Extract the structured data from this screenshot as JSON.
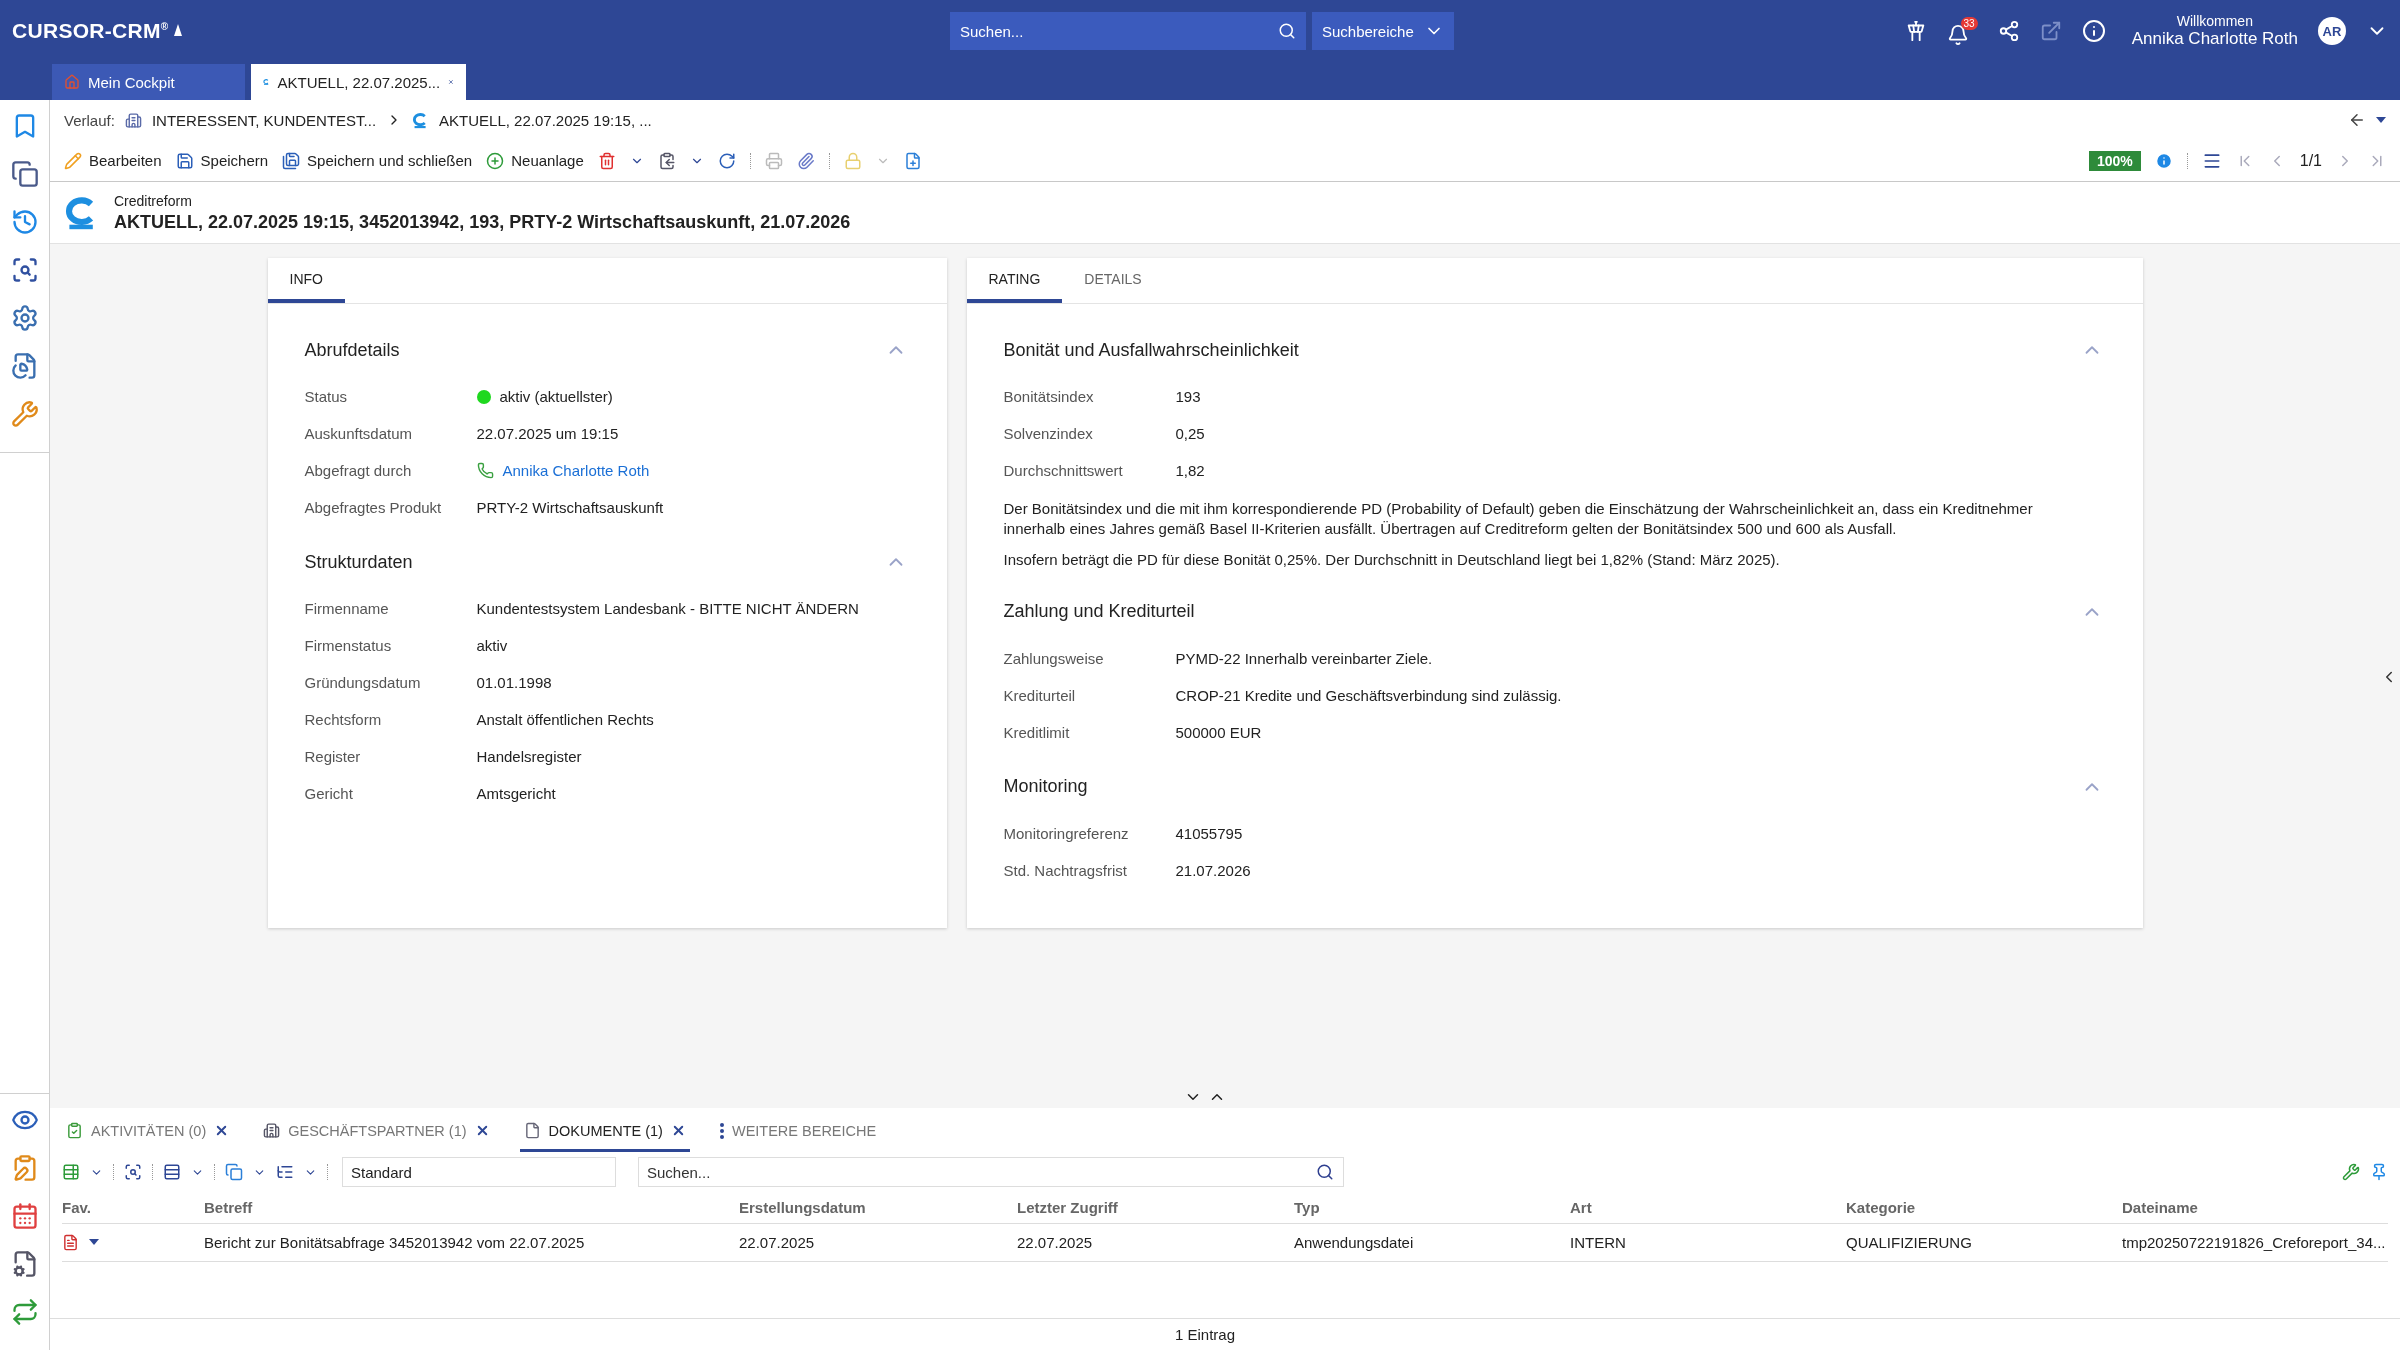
{
  "header": {
    "logo": "CURSOR-CRM$^{®}$",
    "search": {
      "placeholder": "Suchen..."
    },
    "search_areas": "Suchbereiche",
    "notification_count": "33",
    "greeting": "Willkommen",
    "user": "Annika Charlotte Roth",
    "avatar": "AR"
  },
  "main_tabs": [
    {
      "label": "Mein Cockpit",
      "kind": "home",
      "selected": false,
      "closable": false
    },
    {
      "label": "AKTUELL, 22.07.2025...",
      "kind": "record",
      "selected": true,
      "closable": true
    }
  ],
  "breadcrumb": {
    "label": "Verlauf:",
    "items": [
      {
        "label": "INTERESSENT, KUNDENTEST...",
        "kind": "partner"
      },
      {
        "label": "AKTUELL, 22.07.2025 19:15, ...",
        "kind": "record"
      }
    ]
  },
  "toolbar": {
    "actions": [
      {
        "label": "Bearbeiten",
        "kind": "edit"
      },
      {
        "label": "Speichern",
        "kind": "save"
      },
      {
        "label": "Speichern und schließen",
        "kind": "save_close"
      },
      {
        "label": "Neuanlage",
        "kind": "new"
      }
    ],
    "completeness": "100%",
    "pager": "1/1"
  },
  "record": {
    "source": "Creditreform",
    "title": "AKTUELL, 22.07.2025 19:15, 3452013942, 193, PRTY-2 Wirtschaftsauskunft, 21.07.2026"
  },
  "panels": [
    {
      "tabs": [
        {
          "label": "INFO",
          "selected": true
        }
      ],
      "sections": [
        {
          "title": "Abrufdetails",
          "expanded": true,
          "fields": [
            {
              "label": "Status",
              "value": "aktiv (aktuellster)",
              "kind": "status",
              "color": "#1fd81f"
            },
            {
              "label": "Auskunftsdatum",
              "value": "22.07.2025 um 19:15",
              "kind": "text"
            },
            {
              "label": "Abgefragt durch",
              "value": "Annika Charlotte Roth",
              "kind": "link"
            },
            {
              "label": "Abgefragtes Produkt",
              "value": "PRTY-2 Wirtschaftsauskunft",
              "kind": "text"
            }
          ]
        },
        {
          "title": "Strukturdaten",
          "expanded": true,
          "fields": [
            {
              "label": "Firmenname",
              "value": "Kundentestsystem Landesbank - BITTE NICHT ÄNDERN",
              "kind": "text"
            },
            {
              "label": "Firmenstatus",
              "value": "aktiv",
              "kind": "text"
            },
            {
              "label": "Gründungsdatum",
              "value": "01.01.1998",
              "kind": "text"
            },
            {
              "label": "Rechtsform",
              "value": "Anstalt öffentlichen Rechts",
              "kind": "text"
            },
            {
              "label": "Register",
              "value": "Handelsregister",
              "kind": "text"
            },
            {
              "label": "Gericht",
              "value": "Amtsgericht",
              "kind": "text"
            }
          ]
        }
      ]
    },
    {
      "tabs": [
        {
          "label": "RATING",
          "selected": true
        },
        {
          "label": "DETAILS",
          "selected": false
        }
      ],
      "sections": [
        {
          "title": "Bonität und Ausfallwahrscheinlichkeit",
          "expanded": true,
          "fields": [
            {
              "label": "Bonitätsindex",
              "value": "193",
              "kind": "text"
            },
            {
              "label": "Solvenzindex",
              "value": "0,25",
              "kind": "text"
            },
            {
              "label": "Durchschnittswert",
              "value": "1,82",
              "kind": "text"
            }
          ],
          "notes": [
            "Der Bonitätsindex und die mit ihm korrespondierende PD (Probability of Default) geben die Einschätzung der Wahrscheinlichkeit an, dass ein Kreditnehmer innerhalb eines Jahres gemäß Basel II-Kriterien ausfällt. Übertragen auf Creditreform gelten der Bonitätsindex 500 und 600 als Ausfall.",
            "Insofern beträgt die PD für diese Bonität 0,25%. Der Durchschnitt in Deutschland liegt bei 1,82% (Stand: März 2025)."
          ]
        },
        {
          "title": "Zahlung und Krediturteil",
          "expanded": true,
          "fields": [
            {
              "label": "Zahlungsweise",
              "value": "PYMD-22 Innerhalb vereinbarter Ziele.",
              "kind": "text"
            },
            {
              "label": "Krediturteil",
              "value": "CROP-21 Kredite und Geschäftsverbindung sind zulässig.",
              "kind": "text"
            },
            {
              "label": "Kreditlimit",
              "value": "500000 EUR",
              "kind": "text"
            }
          ]
        },
        {
          "title": "Monitoring",
          "expanded": true,
          "fields": [
            {
              "label": "Monitoringreferenz",
              "value": "41055795",
              "kind": "text"
            },
            {
              "label": "Std. Nachtragsfrist",
              "value": "21.07.2026",
              "kind": "text"
            }
          ]
        }
      ]
    }
  ],
  "bottom": {
    "tabs": [
      {
        "label": "AKTIVITÄTEN (0)",
        "kind": "activities",
        "selected": false
      },
      {
        "label": "GESCHÄFTSPARTNER (1)",
        "kind": "partners",
        "selected": false
      },
      {
        "label": "DOKUMENTE (1)",
        "kind": "documents",
        "selected": true
      }
    ],
    "more": "WEITERE BEREICHE",
    "view": "Standard",
    "search": {
      "placeholder": "Suchen..."
    },
    "columns": [
      "Fav.",
      "Betreff",
      "Erstellungsdatum",
      "Letzter Zugriff",
      "Typ",
      "Art",
      "Kategorie",
      "Dateiname"
    ],
    "rows": [
      {
        "cells": [
          "",
          "Bericht zur Bonitätsabfrage 3452013942 vom 22.07.2025",
          "22.07.2025",
          "22.07.2025",
          "Anwendungsdatei",
          "INTERN",
          "QUALIFIZIERUNG",
          "tmp20250722191826_Creforeport_34..."
        ]
      }
    ],
    "footer": "1 Eintrag"
  }
}
